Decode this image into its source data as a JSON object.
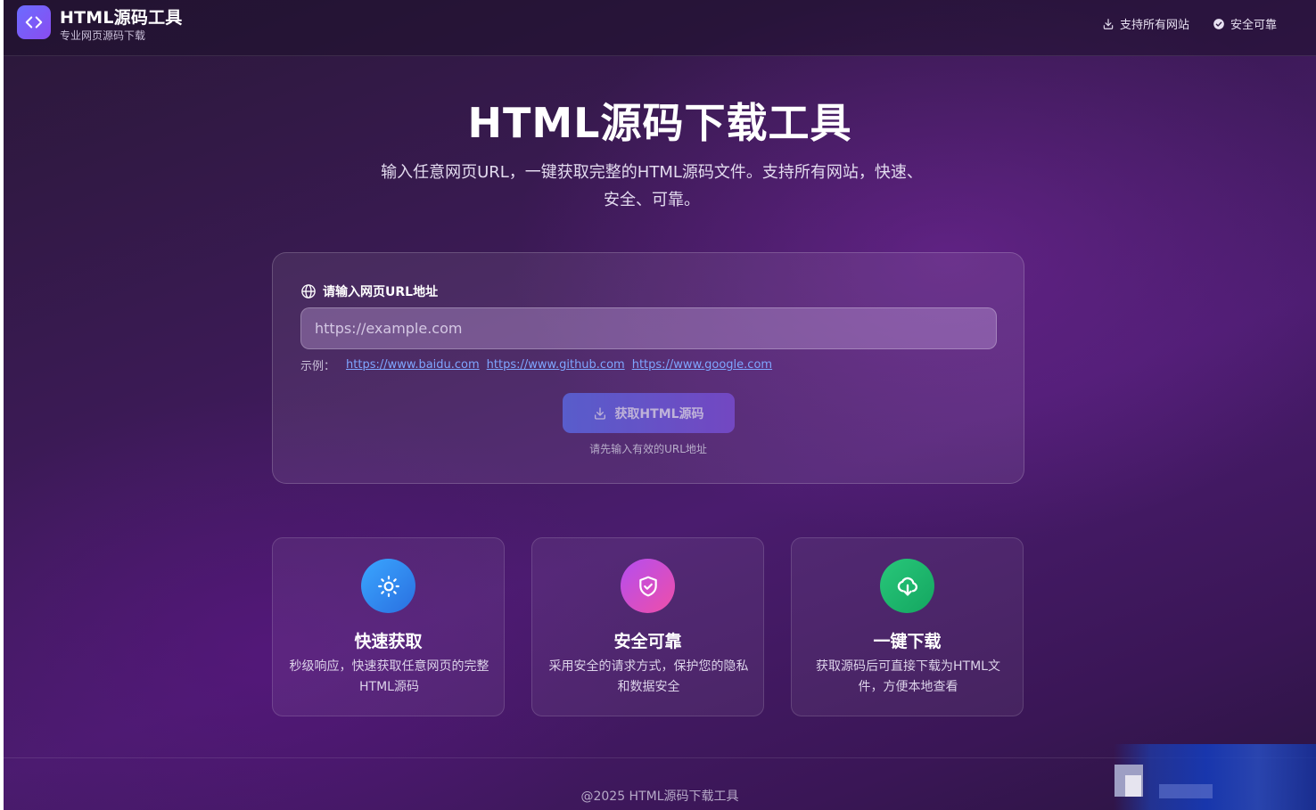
{
  "header": {
    "brand_title": "HTML源码工具",
    "brand_subtitle": "专业网页源码下载",
    "links": [
      {
        "label": "支持所有网站",
        "icon": "download-icon"
      },
      {
        "label": "安全可靠",
        "icon": "check-circle-icon"
      }
    ]
  },
  "hero": {
    "title": "HTML源码下载工具",
    "description": "输入任意网页URL，一键获取完整的HTML源码文件。支持所有网站，快速、安全、可靠。"
  },
  "form": {
    "label": "请输入网页URL地址",
    "placeholder": "https://example.com",
    "value": "",
    "examples_label": "示例：",
    "examples": [
      "https://www.baidu.com",
      "https://www.github.com",
      "https://www.google.com"
    ],
    "button_label": "获取HTML源码",
    "hint": "请先输入有效的URL地址"
  },
  "features": [
    {
      "title": "快速获取",
      "description": "秒级响应，快速获取任意网页的完整HTML源码",
      "icon": "sun-icon",
      "color": "#2a8ff0"
    },
    {
      "title": "安全可靠",
      "description": "采用安全的请求方式，保护您的隐私和数据安全",
      "icon": "shield-icon",
      "color": "#d94fd0"
    },
    {
      "title": "一键下载",
      "description": "获取源码后可直接下载为HTML文件，方便本地查看",
      "icon": "cloud-download-icon",
      "color": "#1fb870"
    }
  ],
  "footer": {
    "text": "@2025 HTML源码下载工具"
  },
  "colors": {
    "accent": "#6b6cff",
    "link": "#7fa6ff"
  }
}
